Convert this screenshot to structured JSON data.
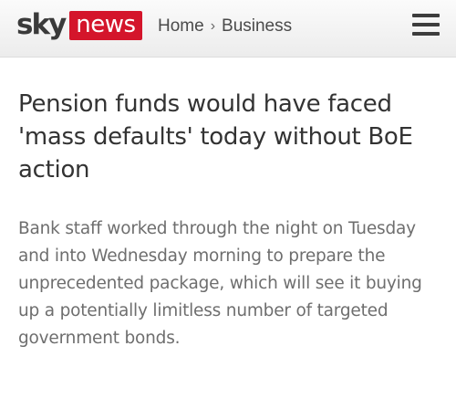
{
  "header": {
    "logo_sky": "sky",
    "logo_news": "news",
    "breadcrumb": {
      "home": "Home",
      "separator": "›",
      "section": "Business"
    },
    "menu_icon": "hamburger-menu-icon",
    "brand_color": "#d4152b"
  },
  "article": {
    "headline": "Pension funds would have faced 'mass defaults' today without BoE action",
    "standfirst": "Bank staff worked through the night on Tuesday and into Wednesday morning to prepare the unprecedented package, which will see it buying up a potentially limitless number of targeted government bonds."
  }
}
